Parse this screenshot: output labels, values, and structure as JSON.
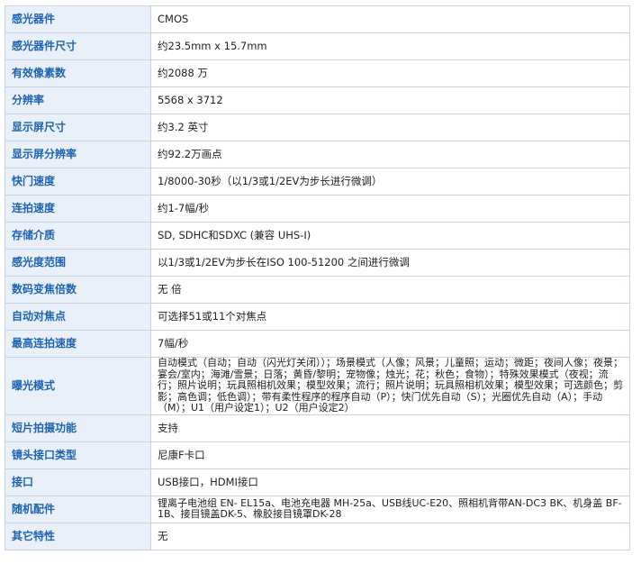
{
  "specs": [
    {
      "label": "感光器件",
      "value": "CMOS"
    },
    {
      "label": "感光器件尺寸",
      "value": "约23.5mm x 15.7mm"
    },
    {
      "label": "有效像素数",
      "value": "约2088 万"
    },
    {
      "label": "分辨率",
      "value": "5568 x 3712"
    },
    {
      "label": "显示屏尺寸",
      "value": "约3.2 英寸"
    },
    {
      "label": "显示屏分辨率",
      "value": "约92.2万画点"
    },
    {
      "label": "快门速度",
      "value": "1/8000-30秒（以1/3或1/2EV为步长进行微调）"
    },
    {
      "label": "连拍速度",
      "value": "约1-7幅/秒"
    },
    {
      "label": "存储介质",
      "value": "SD, SDHC和SDXC (兼容 UHS-I)"
    },
    {
      "label": "感光度范围",
      "value": "以1/3或1/2EV为步长在ISO 100-51200 之间进行微调"
    },
    {
      "label": "数码变焦倍数",
      "value": "无 倍"
    },
    {
      "label": "自动对焦点",
      "value": "可选择51或11个对焦点"
    },
    {
      "label": "最高连拍速度",
      "value": "7幅/秒"
    },
    {
      "label": "曝光模式",
      "value": "自动模式（自动；自动（闪光灯关闭））；场景模式（人像；风景；儿童照；运动；微距；夜间人像；夜景；宴会/室内；海滩/雪景；日落；黄昏/黎明；宠物像；烛光；花；秋色；食物）；特殊效果模式（夜视；流行；照片说明；玩具照相机效果；模型效果；流行；照片说明；玩具照相机效果；模型效果；可选颜色；剪影；高色调；低色调）；带有柔性程序的程序自动（P）；快门优先自动（S）；光圈优先自动（A）；手动（M）；U1（用户设定1）；U2（用户设定2）"
    },
    {
      "label": "短片拍摄功能",
      "value": "支持"
    },
    {
      "label": "镜头接口类型",
      "value": "尼康F卡口"
    },
    {
      "label": "接口",
      "value": "USB接口，HDMI接口"
    },
    {
      "label": "随机配件",
      "value": "锂离子电池组 EN- EL15a、电池充电器 MH-25a、USB线UC-E20、照相机背带AN-DC3 BK、机身盖 BF-1B、接目镜盖DK-5、橡胶接目镜罩DK-28"
    },
    {
      "label": "其它特性",
      "value": "无"
    }
  ]
}
